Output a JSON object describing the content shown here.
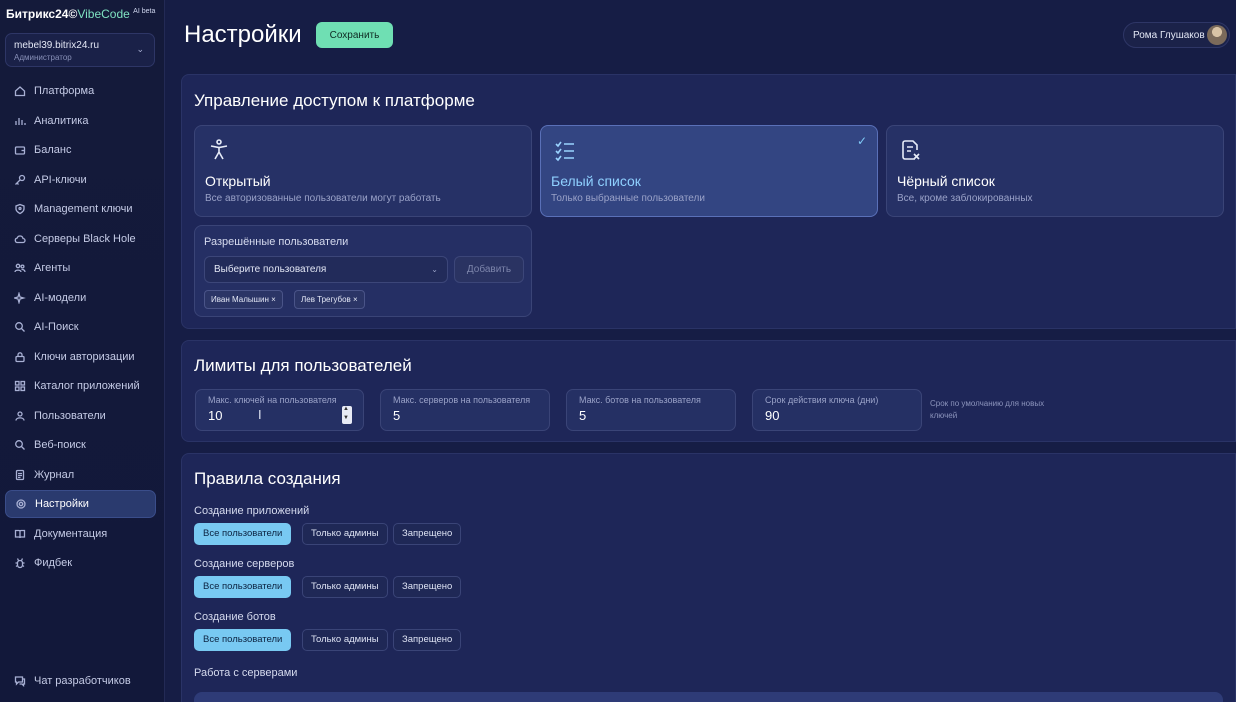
{
  "brand": {
    "name": "Битрикс24",
    "separator": "©",
    "product": "VibeCode",
    "badge": "AI beta"
  },
  "account": {
    "domain": "mebel39.bitrix24.ru",
    "role": "Администратор"
  },
  "sidebar": {
    "items": [
      {
        "label": "Платформа",
        "icon": "home-icon"
      },
      {
        "label": "Аналитика",
        "icon": "bar-chart-icon"
      },
      {
        "label": "Баланс",
        "icon": "wallet-icon"
      },
      {
        "label": "API-ключи",
        "icon": "key-icon"
      },
      {
        "label": "Management ключи",
        "icon": "shield-key-icon"
      },
      {
        "label": "Серверы Black Hole",
        "icon": "cloud-icon"
      },
      {
        "label": "Агенты",
        "icon": "users-group-icon"
      },
      {
        "label": "AI-модели",
        "icon": "sparkles-icon"
      },
      {
        "label": "AI-Поиск",
        "icon": "search-icon"
      },
      {
        "label": "Ключи авторизации",
        "icon": "lock-icon"
      },
      {
        "label": "Каталог приложений",
        "icon": "grid-icon"
      },
      {
        "label": "Пользователи",
        "icon": "users-icon"
      },
      {
        "label": "Веб-поиск",
        "icon": "globe-search-icon"
      },
      {
        "label": "Журнал",
        "icon": "document-icon"
      },
      {
        "label": "Настройки",
        "icon": "gear-icon",
        "active": true
      },
      {
        "label": "Документация",
        "icon": "book-icon"
      },
      {
        "label": "Фидбек",
        "icon": "bug-icon"
      }
    ],
    "bottom": {
      "label": "Чат разработчиков",
      "icon": "chat-icon"
    }
  },
  "header": {
    "title": "Настройки",
    "save_label": "Сохранить",
    "user_name": "Рома Глушаков"
  },
  "access": {
    "title": "Управление доступом к платформе",
    "modes": [
      {
        "title": "Открытый",
        "desc": "Все авторизованные пользователи могут работать",
        "icon": "accessibility-icon",
        "selected": false
      },
      {
        "title": "Белый список",
        "desc": "Только выбранные пользователи",
        "icon": "checklist-icon",
        "selected": true
      },
      {
        "title": "Чёрный список",
        "desc": "Все, кроме заблокированных",
        "icon": "document-x-icon",
        "selected": false
      }
    ],
    "allowed_label": "Разрешённые пользователи",
    "select_placeholder": "Выберите пользователя",
    "add_label": "Добавить",
    "tags": [
      "Иван Малышин ×",
      "Лев Трегубов ×"
    ]
  },
  "limits": {
    "title": "Лимиты для пользователей",
    "fields": [
      {
        "label": "Макс. ключей на пользователя",
        "value": "10"
      },
      {
        "label": "Макс. серверов на пользователя",
        "value": "5"
      },
      {
        "label": "Макс. ботов на пользователя",
        "value": "5"
      },
      {
        "label": "Срок действия ключа (дни)",
        "value": "90"
      }
    ],
    "hint": "Срок по умолчанию для новых ключей"
  },
  "rules": {
    "title": "Правила создания",
    "groups": [
      {
        "label": "Создание приложений",
        "options": [
          "Все пользователи",
          "Только админы",
          "Запрещено"
        ],
        "selected": 0
      },
      {
        "label": "Создание серверов",
        "options": [
          "Все пользователи",
          "Только админы",
          "Запрещено"
        ],
        "selected": 0
      },
      {
        "label": "Создание ботов",
        "options": [
          "Все пользователи",
          "Только админы",
          "Запрещено"
        ],
        "selected": 0
      }
    ],
    "servers_label": "Работа с серверами"
  },
  "colors": {
    "accent_green": "#6fdfb3",
    "accent_blue": "#78c9f2",
    "background": "#161d45"
  }
}
